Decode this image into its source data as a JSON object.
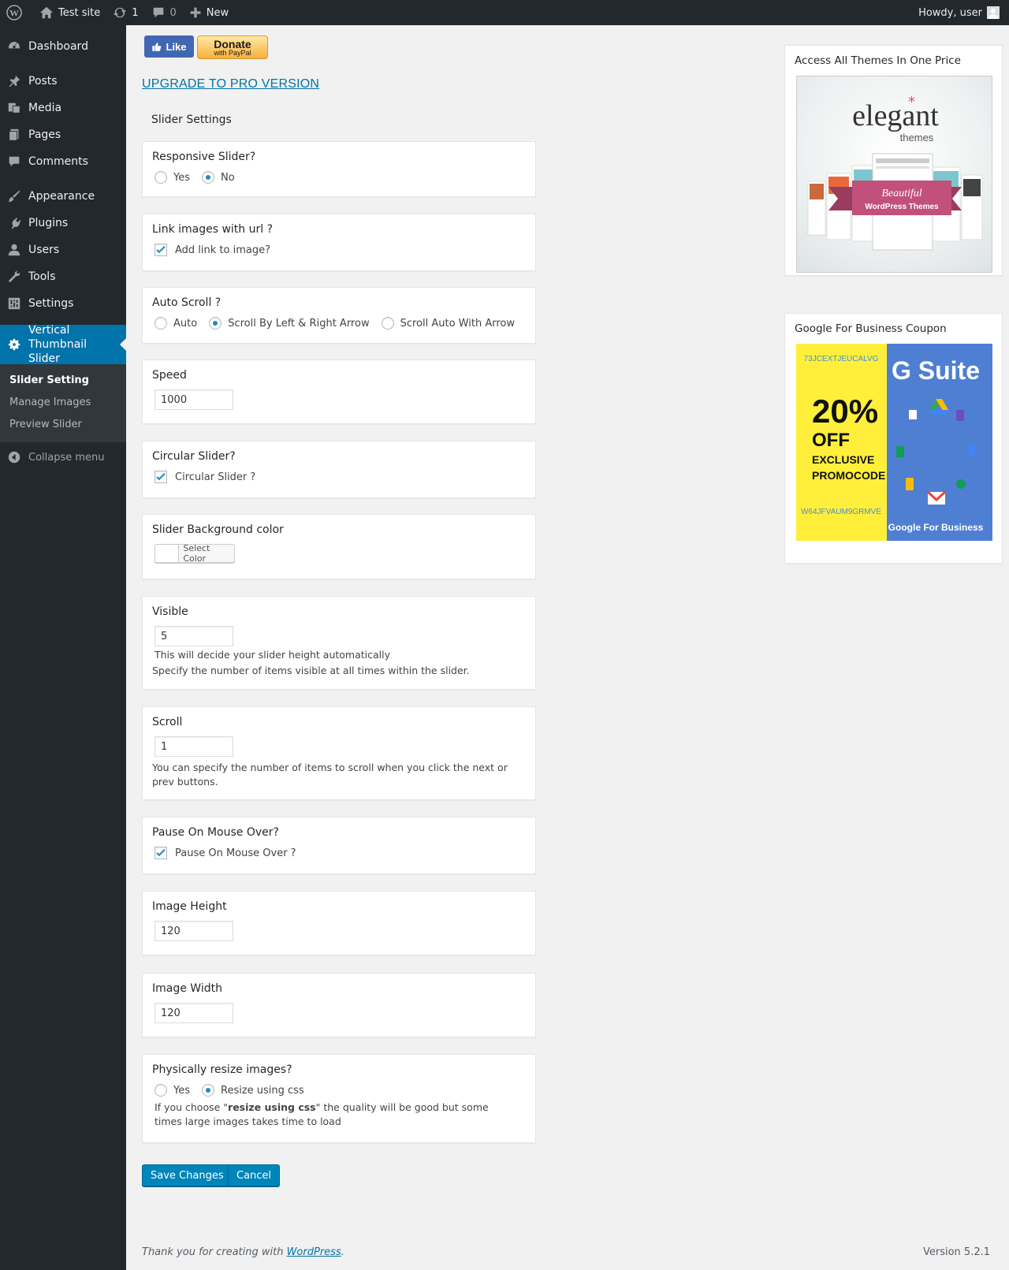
{
  "adminbar": {
    "site_name": "Test site",
    "updates_count": "1",
    "comments_count": "0",
    "new_label": "New",
    "howdy": "Howdy, user"
  },
  "sidebar": {
    "items": [
      {
        "label": "Dashboard",
        "icon": "dashboard-icon"
      },
      {
        "label": "Posts",
        "icon": "pin-icon"
      },
      {
        "label": "Media",
        "icon": "media-icon"
      },
      {
        "label": "Pages",
        "icon": "pages-icon"
      },
      {
        "label": "Comments",
        "icon": "comment-icon"
      },
      {
        "label": "Appearance",
        "icon": "brush-icon"
      },
      {
        "label": "Plugins",
        "icon": "plug-icon"
      },
      {
        "label": "Users",
        "icon": "user-icon"
      },
      {
        "label": "Tools",
        "icon": "wrench-icon"
      },
      {
        "label": "Settings",
        "icon": "settings-icon"
      }
    ],
    "current": {
      "label": "Vertical Thumbnail Slider",
      "icon": "gear-icon"
    },
    "submenu": [
      "Slider Setting",
      "Manage Images",
      "Preview Slider"
    ],
    "collapse": "Collapse menu"
  },
  "top": {
    "like": "Like",
    "donate_main": "Donate",
    "donate_sub": "with PayPal",
    "upgrade": "UPGRADE TO PRO VERSION",
    "section_title": "Slider Settings"
  },
  "settings": {
    "responsive": {
      "title": "Responsive Slider?",
      "options": [
        "Yes",
        "No"
      ],
      "selected": "No"
    },
    "link_images": {
      "title": "Link images with url ?",
      "label": "Add link to image?",
      "checked": true
    },
    "auto_scroll": {
      "title": "Auto Scroll ?",
      "options": [
        "Auto",
        "Scroll By Left & Right Arrow",
        "Scroll Auto With Arrow"
      ],
      "selected": "Scroll By Left & Right Arrow"
    },
    "speed": {
      "title": "Speed",
      "value": "1000"
    },
    "circular": {
      "title": "Circular Slider?",
      "label": "Circular Slider ?",
      "checked": true
    },
    "bg_color": {
      "title": "Slider Background color",
      "button": "Select Color"
    },
    "visible": {
      "title": "Visible",
      "value": "5",
      "help1": "This will decide your slider height automatically",
      "help2": "Specify the number of items visible at all times within the slider."
    },
    "scroll": {
      "title": "Scroll",
      "value": "1",
      "help": "You can specify the number of items to scroll when you click the next or prev buttons."
    },
    "pause": {
      "title": "Pause On Mouse Over?",
      "label": "Pause On Mouse Over ?",
      "checked": true
    },
    "image_height": {
      "title": "Image Height",
      "value": "120"
    },
    "image_width": {
      "title": "Image Width",
      "value": "120"
    },
    "resize": {
      "title": "Physically resize images?",
      "options": [
        "Yes",
        "Resize using css"
      ],
      "selected": "Resize using css",
      "help_pre": "If you choose \"",
      "help_bold": "resize using css",
      "help_post": "\" the quality will be good but some times large images takes time to load"
    }
  },
  "actions": {
    "save": "Save Changes",
    "cancel": "Cancel"
  },
  "widgets": {
    "elegant": {
      "title": "Access All Themes In One Price",
      "brand": "elegant",
      "brand_sub": "themes",
      "ribbon1": "Beautiful",
      "ribbon2": "WordPress Themes"
    },
    "gsuite": {
      "title": "Google For Business Coupon",
      "code_top": "73JCEXTJEUCALVG",
      "discount": "20%",
      "off": "OFF",
      "line1": "EXCLUSIVE",
      "line2": "PROMOCODE",
      "code_bottom": "W64JFVAUM9GRMVE",
      "brand": "G Suite",
      "brand_bottom": "Google For Business"
    }
  },
  "footer": {
    "thanks_pre": "Thank you for creating with ",
    "thanks_link": "WordPress",
    "thanks_post": ".",
    "version": "Version 5.2.1"
  },
  "colors": {
    "accent": "#0073aa",
    "sidebar_bg": "#23282d",
    "button": "#0085ba",
    "facebook": "#4267b2"
  }
}
